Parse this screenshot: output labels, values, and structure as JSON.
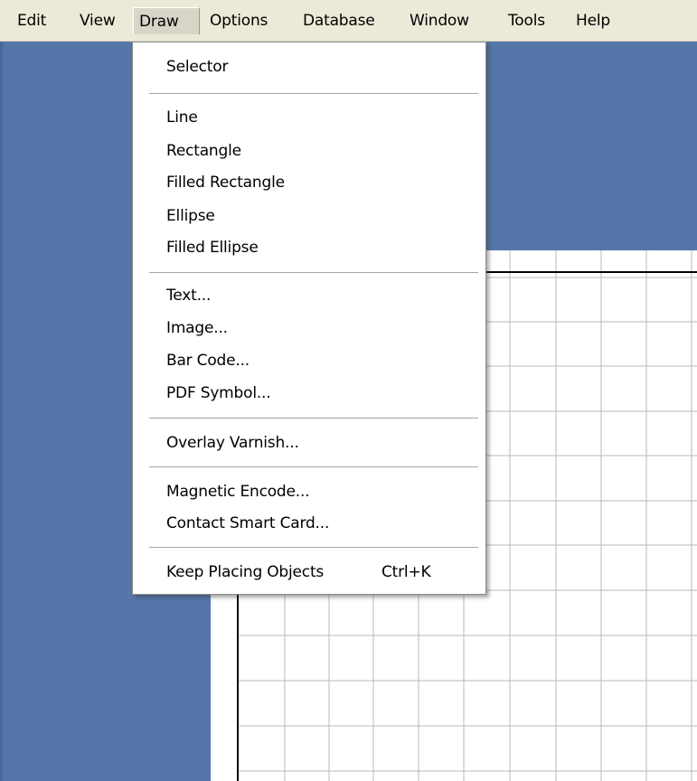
{
  "menubar": {
    "items": [
      {
        "label": "Edit"
      },
      {
        "label": "View"
      },
      {
        "label": "Draw"
      },
      {
        "label": "Options"
      },
      {
        "label": "Database"
      },
      {
        "label": "Window"
      },
      {
        "label": "Tools"
      },
      {
        "label": "Help"
      }
    ],
    "active_item": "Draw"
  },
  "draw_menu": {
    "items": [
      {
        "label": "Selector"
      },
      {
        "label": "Line"
      },
      {
        "label": "Rectangle"
      },
      {
        "label": "Filled Rectangle"
      },
      {
        "label": "Ellipse"
      },
      {
        "label": "Filled Ellipse"
      },
      {
        "label": "Text..."
      },
      {
        "label": "Image..."
      },
      {
        "label": "Bar Code..."
      },
      {
        "label": "PDF Symbol..."
      },
      {
        "label": "Overlay Varnish..."
      },
      {
        "label": "Magnetic Encode..."
      },
      {
        "label": "Contact Smart Card..."
      },
      {
        "label": "Keep Placing Objects",
        "shortcut": "Ctrl+K"
      }
    ]
  },
  "colors": {
    "workspace": "#5676a9",
    "menubar": "#ece9d8",
    "canvas": "#ffffff",
    "grid": "#b8b8b8"
  }
}
